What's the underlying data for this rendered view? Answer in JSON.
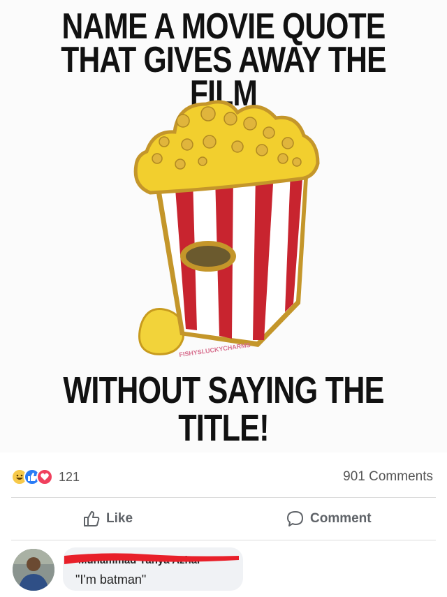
{
  "meme": {
    "title_line1": "NAME A MOVIE QUOTE",
    "title_line2": "THAT GIVES AWAY THE FILM",
    "bottom_text": "WITHOUT SAYING THE TITLE!",
    "watermark": "FISHYSLUCKYCHARMS"
  },
  "post": {
    "reaction_icons": [
      "haha-icon",
      "like-icon",
      "love-icon"
    ],
    "reaction_count": "121",
    "comments_count": "901 Comments",
    "like_label": "Like",
    "comment_label": "Comment"
  },
  "comment": {
    "author": "Muhammad Yahya Azhar",
    "text": "\"I'm batman\""
  },
  "colors": {
    "like_blue": "#2a7cf6",
    "love_red": "#f0405d",
    "haha_yellow": "#f7c94a",
    "popcorn_red": "#c8242f",
    "redaction": "#e8202a"
  }
}
